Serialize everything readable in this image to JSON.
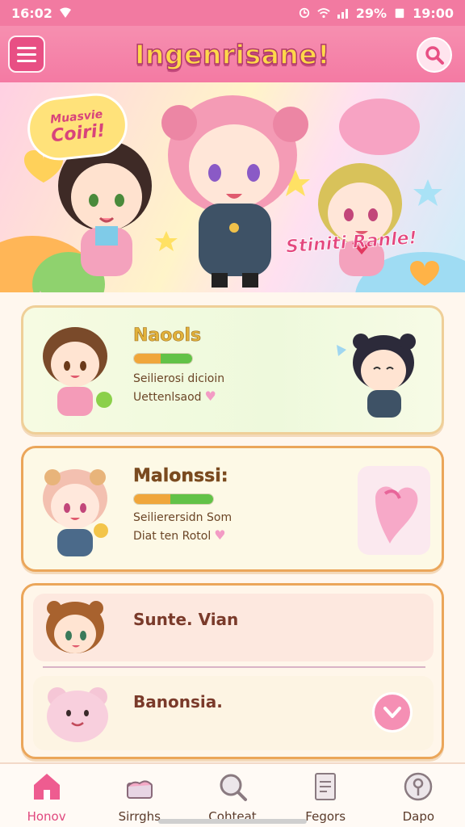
{
  "status_bar": {
    "time": "16:02",
    "battery": "29%",
    "clock_right": "19:00"
  },
  "app": {
    "title": "Ingenrisane!"
  },
  "hero": {
    "bubble_line1": "Muasvie",
    "bubble_line2": "Coiri!",
    "caption": "Stiniti Ranle!"
  },
  "cards": [
    {
      "title": "Naools",
      "progress": 0.46,
      "line1": "Seilierosi dicioin",
      "line2": "Uettenlsaod"
    },
    {
      "title": "Malonssi:",
      "progress": 0.46,
      "line1": "Seilierersidn Som",
      "line2": "Diat ten Rotol"
    }
  ],
  "list": {
    "row1": "Sunte. Vian",
    "row2": "Banonsia."
  },
  "nav": [
    {
      "label": "Honov",
      "icon": "home-icon"
    },
    {
      "label": "Sirrghs",
      "icon": "cake-icon"
    },
    {
      "label": "Cohteat",
      "icon": "search-icon"
    },
    {
      "label": "Fegors",
      "icon": "document-icon"
    },
    {
      "label": "Dapo",
      "icon": "pin-icon"
    }
  ],
  "colors": {
    "primary": "#f47aa3",
    "accent": "#e0487e",
    "card_border": "#eba65a"
  }
}
